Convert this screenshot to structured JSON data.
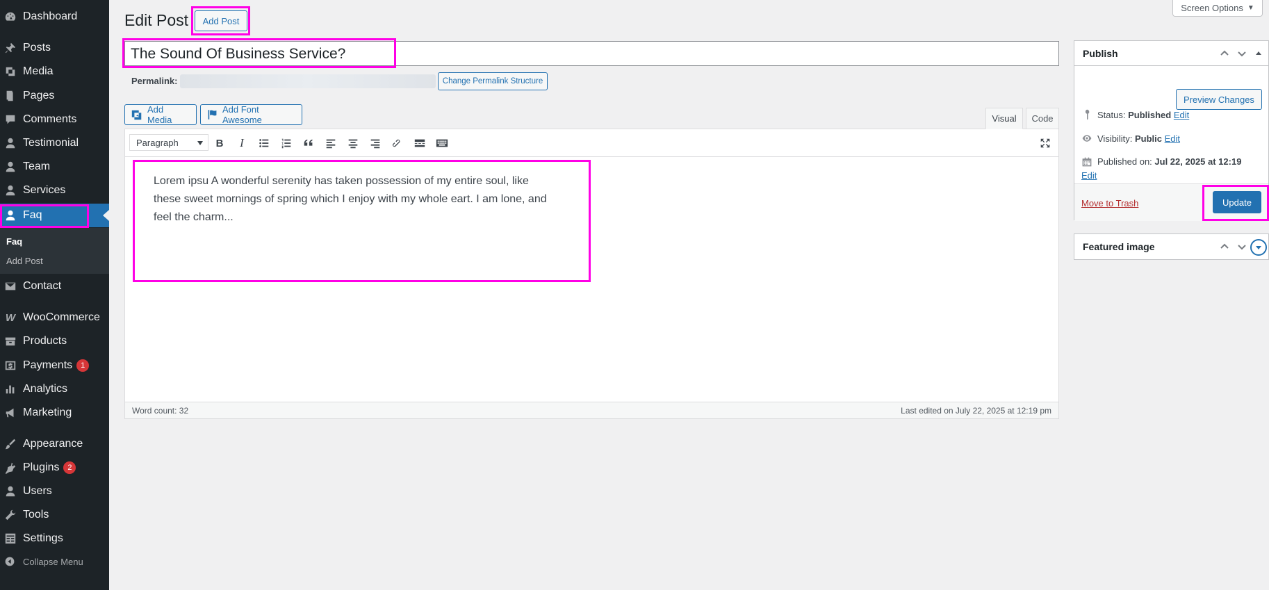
{
  "sidebar": {
    "items": [
      {
        "label": "Dashboard",
        "icon": "dashboard-icon"
      },
      {
        "label": "Posts",
        "icon": "pin-icon"
      },
      {
        "label": "Media",
        "icon": "media-icon"
      },
      {
        "label": "Pages",
        "icon": "pages-icon"
      },
      {
        "label": "Comments",
        "icon": "comments-icon"
      },
      {
        "label": "Testimonial",
        "icon": "user-icon"
      },
      {
        "label": "Team",
        "icon": "user-icon"
      },
      {
        "label": "Services",
        "icon": "user-icon"
      },
      {
        "label": "Faq",
        "icon": "user-icon"
      },
      {
        "label": "Contact",
        "icon": "mail-icon"
      },
      {
        "label": "WooCommerce",
        "icon": "woo-icon"
      },
      {
        "label": "Products",
        "icon": "archive-icon"
      },
      {
        "label": "Payments",
        "icon": "dollar-icon",
        "badge": "1"
      },
      {
        "label": "Analytics",
        "icon": "bar-chart-icon"
      },
      {
        "label": "Marketing",
        "icon": "megaphone-icon"
      },
      {
        "label": "Appearance",
        "icon": "brush-icon"
      },
      {
        "label": "Plugins",
        "icon": "plug-icon",
        "badge": "2"
      },
      {
        "label": "Users",
        "icon": "users-icon"
      },
      {
        "label": "Tools",
        "icon": "wrench-icon"
      },
      {
        "label": "Settings",
        "icon": "settings-icon"
      }
    ],
    "submenu": {
      "current": "Faq",
      "add": "Add Post"
    },
    "collapse": "Collapse Menu"
  },
  "header": {
    "screen_options": "Screen Options",
    "title": "Edit Post",
    "add_post": "Add Post"
  },
  "post": {
    "title": "The Sound Of Business Service?",
    "permalink_label": "Permalink:",
    "change_permalink": "Change Permalink Structure"
  },
  "editor": {
    "add_media": "Add Media",
    "add_font_awesome": "Add Font Awesome",
    "tab_visual": "Visual",
    "tab_code": "Code",
    "format": "Paragraph",
    "content": "Lorem ipsu A wonderful serenity has taken possession of my entire soul, like these sweet mornings of spring which I enjoy with my whole eart. I am lone, and feel the charm...",
    "word_count": "Word count: 32",
    "last_edited": "Last edited on July 22, 2025 at 12:19 pm"
  },
  "publish": {
    "title": "Publish",
    "preview": "Preview Changes",
    "status_label": "Status:",
    "status_value": "Published",
    "visibility_label": "Visibility:",
    "visibility_value": "Public",
    "published_label": "Published on:",
    "published_value": "Jul 22, 2025 at 12:19",
    "edit": "Edit",
    "trash": "Move to Trash",
    "update": "Update"
  },
  "featured": {
    "title": "Featured image"
  },
  "colors": {
    "sidebar_bg": "#1d2327",
    "accent": "#2271b1",
    "highlight": "#ff00e6",
    "badge": "#d63638"
  }
}
